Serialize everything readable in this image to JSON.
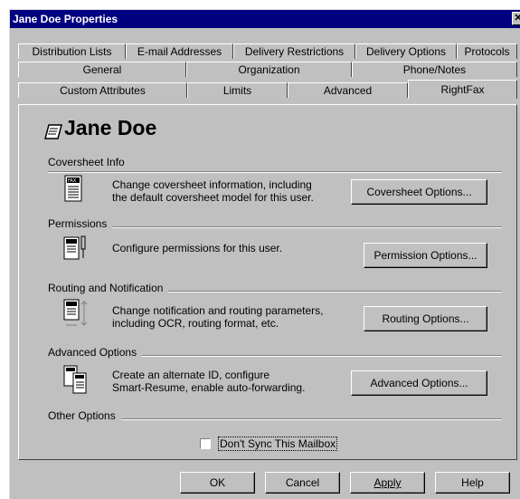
{
  "window": {
    "title": "Jane Doe Properties",
    "close": "✕"
  },
  "tabs": {
    "row1": [
      "Distribution Lists",
      "E-mail Addresses",
      "Delivery Restrictions",
      "Delivery Options",
      "Protocols"
    ],
    "row2": [
      "General",
      "Organization",
      "Phone/Notes"
    ],
    "row3": [
      "Custom Attributes",
      "Limits",
      "Advanced",
      "RightFax"
    ],
    "selected": "RightFax"
  },
  "user": {
    "name": "Jane Doe",
    "icon": "fax-sheet-icon"
  },
  "sections": {
    "coversheet": {
      "label": "Coversheet Info",
      "desc1": "Change coversheet information, including",
      "desc2": "the default coversheet model for this user.",
      "button": "Coversheet Options...",
      "icon": "fax-document-icon"
    },
    "permissions": {
      "label": "Permissions",
      "desc1": "Configure permissions for this user.",
      "button": "Permission Options...",
      "icon": "fax-permission-icon"
    },
    "routing": {
      "label": "Routing and Notification",
      "desc1": "Change notification and routing parameters,",
      "desc2": "including OCR, routing format, etc.",
      "button": "Routing Options...",
      "icon": "fax-routing-icon"
    },
    "advanced": {
      "label": "Advanced Options",
      "desc1": "Create an alternate ID, configure",
      "desc2": "Smart-Resume, enable auto-forwarding.",
      "button": "Advanced Options...",
      "icon": "fax-advanced-icon"
    },
    "other": {
      "label": "Other Options",
      "checkbox_label": "Don't Sync This Mailbox",
      "checked": false
    }
  },
  "footer": {
    "ok": "OK",
    "cancel": "Cancel",
    "apply": "Apply",
    "help": "Help"
  }
}
